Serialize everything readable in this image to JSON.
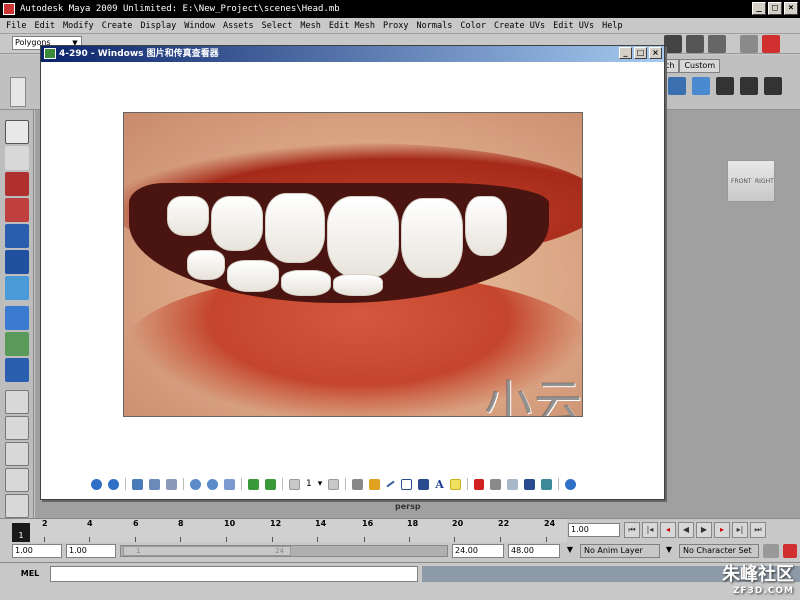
{
  "maya": {
    "title": "Autodesk Maya 2009 Unlimited: E:\\New_Project\\scenes\\Head.mb",
    "menu": [
      "File",
      "Edit",
      "Modify",
      "Create",
      "Display",
      "Window",
      "Assets",
      "Select",
      "Mesh",
      "Edit Mesh",
      "Proxy",
      "Normals",
      "Color",
      "Create UVs",
      "Edit UVs",
      "Help"
    ],
    "mode": "Polygons",
    "shelf_tabs": [
      "ch",
      "Custom"
    ],
    "viewcube": {
      "front": "FRONT",
      "right": "RIGHT"
    },
    "panel_label": "persp"
  },
  "viewer": {
    "title": "4-290 - Windows 图片和传真查看器",
    "watermark": "小云动画",
    "page_number": "1"
  },
  "timeline": {
    "ticks": [
      "2",
      "4",
      "6",
      "8",
      "10",
      "12",
      "14",
      "16",
      "18",
      "20",
      "22",
      "24"
    ],
    "current_frame": "1",
    "current_time": "1.00"
  },
  "range": {
    "start": "1.00",
    "playback_start": "1.00",
    "handle_start": "1",
    "handle_end": "24",
    "playback_end": "24.00",
    "end": "48.00",
    "anim_layer": "No Anim Layer",
    "character_set": "No Character Set"
  },
  "command": {
    "label": "MEL"
  },
  "site": {
    "name": "朱峰社区",
    "url": "ZF3D.COM"
  }
}
